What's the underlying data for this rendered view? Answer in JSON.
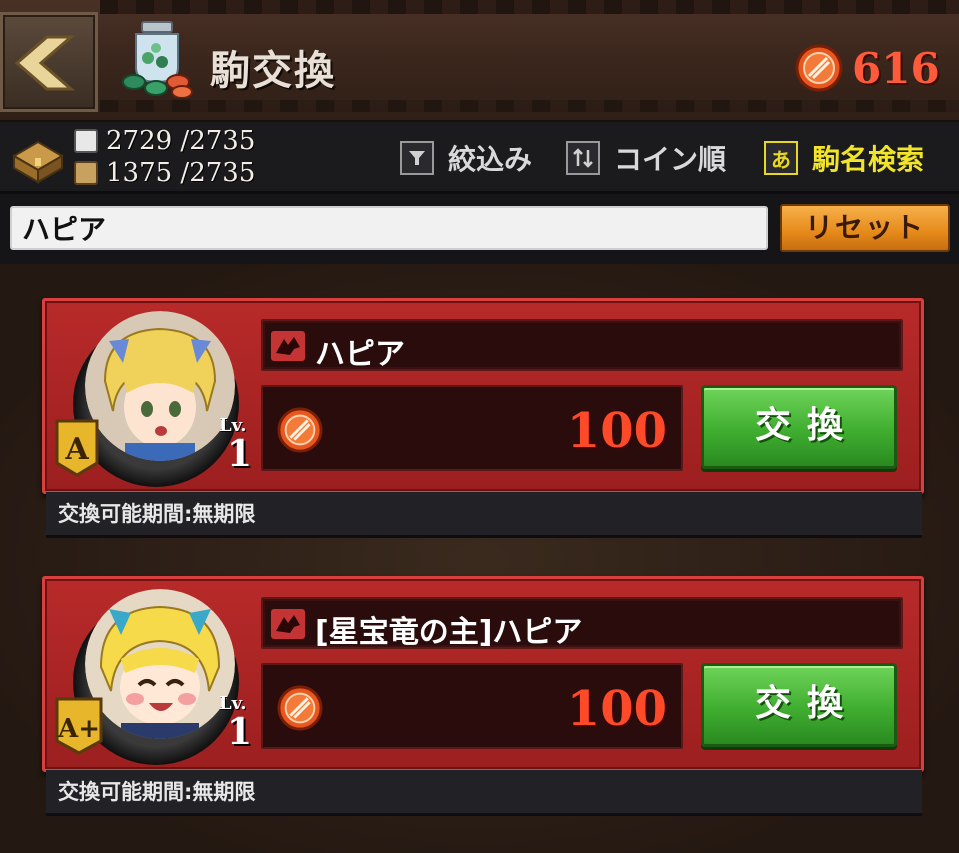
{
  "header": {
    "title": "駒交換",
    "coin_total": "616"
  },
  "toolbar": {
    "count_a": "2729 /2735",
    "count_b": "1375 /2735",
    "filter_label": "絞込み",
    "sort_label": "コイン順",
    "name_search_glyph": "あ",
    "name_search_label": "駒名検索"
  },
  "search": {
    "value": "ハピア",
    "reset_label": "リセット"
  },
  "cards": [
    {
      "name": "ハピア",
      "rank": "A",
      "lv_label": "Lv.",
      "level": "1",
      "price": "100",
      "exchange_label": "交換",
      "period": "交換可能期間:無期限"
    },
    {
      "name": "[星宝竜の主]ハピア",
      "rank": "A+",
      "lv_label": "Lv.",
      "level": "1",
      "price": "100",
      "exchange_label": "交換",
      "period": "交換可能期間:無期限"
    }
  ],
  "colors": {
    "coin": "#ff5a3a",
    "card_red": "#b82a2a",
    "exchange_green": "#3fae30",
    "reset_orange": "#e58a1a",
    "search_highlight": "#f1e42a"
  },
  "icons": [
    "back-arrow-icon",
    "coin-jar-icon",
    "coin-icon",
    "chest-icon",
    "filter-icon",
    "sort-icon",
    "dragon-icon"
  ]
}
